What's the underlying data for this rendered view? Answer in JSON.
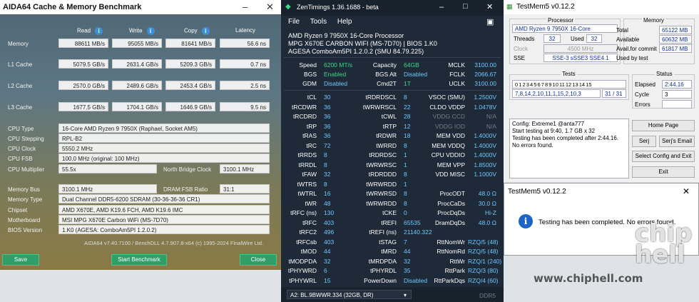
{
  "aida": {
    "title": "AIDA64 Cache & Memory Benchmark",
    "col_headers": [
      "Read",
      "Write",
      "Copy",
      "Latency"
    ],
    "rows": [
      {
        "label": "Memory",
        "read": "88611 MB/s",
        "write": "95055 MB/s",
        "copy": "81641 MB/s",
        "latency": "56.6 ns"
      },
      {
        "label": "L1 Cache",
        "read": "5079.5 GB/s",
        "write": "2631.4 GB/s",
        "copy": "5209.3 GB/s",
        "latency": "0.7 ns"
      },
      {
        "label": "L2 Cache",
        "read": "2570.0 GB/s",
        "write": "2489.6 GB/s",
        "copy": "2453.4 GB/s",
        "latency": "2.5 ns"
      },
      {
        "label": "L3 Cache",
        "read": "1677.5 GB/s",
        "write": "1704.1 GB/s",
        "copy": "1646.9 GB/s",
        "latency": "9.5 ns"
      }
    ],
    "cpu_type_label": "CPU Type",
    "cpu_type": "16-Core AMD Ryzen 9 7950X  (Raphael, Socket AM5)",
    "cpu_stepping_label": "CPU Stepping",
    "cpu_stepping": "RPL-B2",
    "cpu_clock_label": "CPU Clock",
    "cpu_clock": "5550.2 MHz",
    "cpu_fsb_label": "CPU FSB",
    "cpu_fsb": "100.0 MHz  (original: 100 MHz)",
    "cpu_mult_label": "CPU Multiplier",
    "cpu_mult": "55.5x",
    "nb_clock_label": "North Bridge Clock",
    "nb_clock": "3100.1 MHz",
    "mem_bus_label": "Memory Bus",
    "mem_bus": "3100.1 MHz",
    "dram_fsb_label": "DRAM:FSB Ratio",
    "dram_fsb": "31:1",
    "mem_type_label": "Memory Type",
    "mem_type": "Dual Channel DDR5-6200 SDRAM  (30-36-36-36 CR1)",
    "chipset_label": "Chipset",
    "chipset": "AMD X670E, AMD K19.6 FCH, AMD K19.6 IMC",
    "mobo_label": "Motherboard",
    "mobo": "MSI MPG X670E Carbon WiFi (MS-7D70)",
    "bios_label": "BIOS Version",
    "bios": "1.K0  (AGESA: ComboAm5PI 1.2.0.2)",
    "footer": "AIDA64 v7.40.7100 / BenchDLL 4.7.907.8-x64  (c) 1995-2024 FinalWire Ltd.",
    "save": "Save",
    "start": "Start Benchmark",
    "close": "Close"
  },
  "zen": {
    "title": "ZenTimings 1.36.1688 - beta",
    "menu": [
      "File",
      "Tools",
      "Help"
    ],
    "cpu": "AMD Ryzen 9 7950X 16-Core Processor",
    "board": "MPG X670E CARBON WIFI (MS-7D70) | BIOS 1.K0",
    "agesa": "AGESA ComboAm5PI 1.2.0.2 (SMU 84.79.225)",
    "top": [
      [
        "Speed",
        "6200 MT/s",
        "Capacity",
        "64GB",
        "MCLK",
        "3100.00"
      ],
      [
        "BGS",
        "Enabled",
        "BGS Alt",
        "Disabled",
        "FCLK",
        "2066.67"
      ],
      [
        "GDM",
        "Disabled",
        "Cmd2T",
        "1T",
        "UCLK",
        "3100.00"
      ]
    ],
    "timings": [
      [
        "tCL",
        "30",
        "tRDRDSCL",
        "8",
        "VSOC (SMU)",
        "1.2500V"
      ],
      [
        "tRCDWR",
        "36",
        "tWRWRSCL",
        "22",
        "CLDO VDDP",
        "1.0478V"
      ],
      [
        "tRCDRD",
        "36",
        "tCWL",
        "28",
        "VDDG CCD",
        "N/A"
      ],
      [
        "tRP",
        "36",
        "tRTP",
        "12",
        "VDDG IOD",
        "N/A"
      ],
      [
        "tRAS",
        "36",
        "tRDWR",
        "18",
        "MEM VDD",
        "1.4000V"
      ],
      [
        "tRC",
        "72",
        "tWRRD",
        "8",
        "MEM VDDQ",
        "1.4000V"
      ],
      [
        "tRRDS",
        "8",
        "tRDRDSC",
        "1",
        "CPU VDDIO",
        "1.4000V"
      ],
      [
        "tRRDL",
        "8",
        "tWRWRSC",
        "1",
        "MEM VPP",
        "1.8500V"
      ],
      [
        "tFAW",
        "32",
        "tRDRDDD",
        "8",
        "VDD MISC",
        "1.1000V"
      ],
      [
        "tWTRS",
        "8",
        "tWRWRDD",
        "1",
        "",
        ""
      ],
      [
        "tWTRL",
        "16",
        "tWRWRSD",
        "8",
        "ProcODT",
        "48.0 Ω"
      ],
      [
        "tWR",
        "48",
        "tWRWRDD",
        "8",
        "ProcCaDs",
        "30.0 Ω"
      ],
      [
        "tRFC (ns)",
        "130",
        "tCKE",
        "0",
        "ProcDqDs",
        "Hi-Z"
      ],
      [
        "tRFC",
        "403",
        "tREFI",
        "65535",
        "DramDqDs",
        "48.0 Ω"
      ],
      [
        "tRFC2",
        "496",
        "tREFI (ns)",
        "21140.322",
        "",
        ""
      ],
      [
        "tRFCsb",
        "403",
        "tSTAG",
        "7",
        "RttNomWr",
        "RZQ/5 (48)"
      ],
      [
        "tMOD",
        "44",
        "tMRD",
        "44",
        "RttNomRd",
        "RZQ/5 (48)"
      ],
      [
        "tMODPDA",
        "32",
        "tMRDPDA",
        "32",
        "RttWr",
        "RZQ/1 (240)"
      ],
      [
        "tPHYWRD",
        "6",
        "tPHYRDL",
        "35",
        "RttPark",
        "RZQ/3 (80)"
      ],
      [
        "tPHYWRL",
        "15",
        "PowerDown",
        "Disabled",
        "RttParkDqs",
        "RZQ/4 (60)"
      ]
    ],
    "dimm": "A2: BL.9BWWR.334 (32GB, DR)",
    "ddr": "DDR5"
  },
  "tm": {
    "title": "TestMem5 v0.12.2",
    "processor_label": "Processor",
    "cpu": "AMD Ryzen 9 7950X 16-Core",
    "threads_label": "Threads",
    "threads": "32",
    "used_label": "Used",
    "used": "32",
    "clock_label": "Clock",
    "clock": "4500 MHz",
    "sse_label": "SSE",
    "sse": "SSE-3 sSSE3 SSE4.1",
    "memory_label": "Memory",
    "total_label": "Total",
    "total": "65122 MB",
    "avail_label": "Available",
    "avail": "60632 MB",
    "commit_label": "Avail.for commit",
    "commit": "61817 MB",
    "usedby_label": "Used by test",
    "usedby": "",
    "tests_label": "Tests",
    "test_nums": "0 1 2 3 4 5 6 7 8 9 10 11 12 13 14 15",
    "test_seq": "7,8,14,2,10,11,1,15,2,10,3",
    "test_prog": "31 / 31",
    "status_label": "Status",
    "elapsed_label": "Elapsed",
    "elapsed": "2:44.16",
    "cycle_label": "Cycle",
    "cycle": "3",
    "errors_label": "Errors",
    "errors": "",
    "log": [
      "Config: Extreme1 @anta777",
      "Start testing at 9:40, 1.7 GB x 32",
      "Testing has been completed after 2:44.16.",
      "No errors found."
    ],
    "home": "Home Page",
    "serj": "Serj",
    "serj_email": "Serj's Email",
    "select_cfg": "Select Config and Exit",
    "exit": "Exit"
  },
  "dialog": {
    "title": "TestMem5 v0.12.2",
    "message": "Testing has been completed. No errors found."
  },
  "watermark": {
    "logo": "chip hell",
    "site": "www.chiphell.com"
  }
}
